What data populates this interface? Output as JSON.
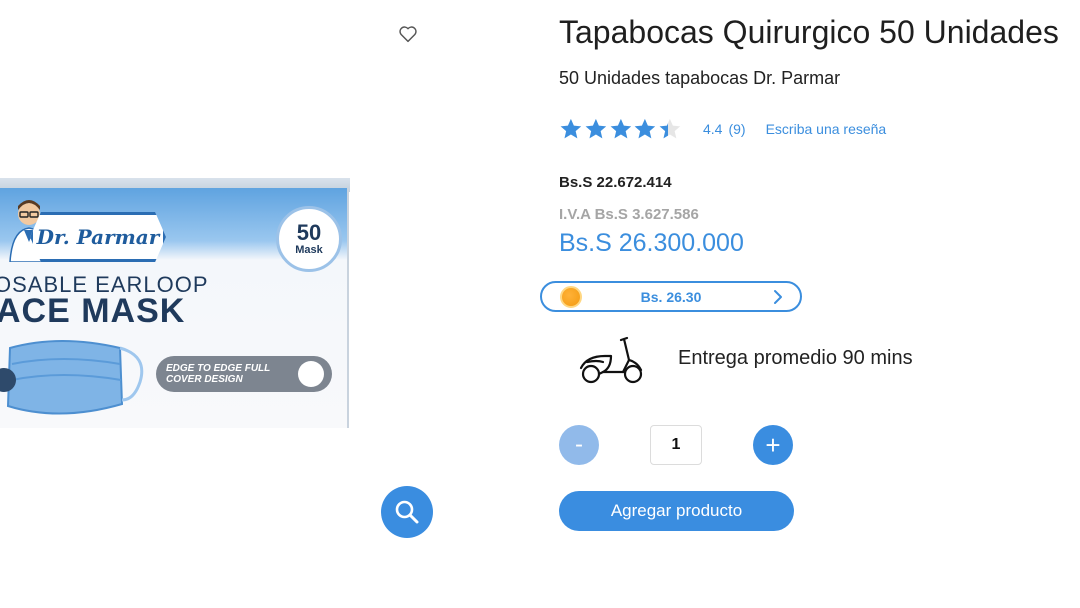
{
  "product": {
    "title": "Tapabocas Quirurgico 50 Unidades",
    "subtitle": "50 Unidades tapabocas Dr. Parmar",
    "image": {
      "brand": "Dr. Parmar",
      "count_number": "50",
      "count_unit": "Mask",
      "line1": "OSABLE EARLOOP",
      "line2": "ACE MASK",
      "feature": "EDGE TO EDGE FULL COVER DESIGN"
    }
  },
  "rating": {
    "value": "4.4",
    "count": "(9)",
    "review_link": "Escriba una reseña",
    "stars_out_of_5": 4.4
  },
  "price": {
    "base": "Bs.S 22.672.414",
    "tax": "I.V.A Bs.S 3.627.586",
    "total": "Bs.S 26.300.000"
  },
  "currency_pill": {
    "label": "Bs. 26.30"
  },
  "delivery": {
    "text": "Entrega promedio 90 mins"
  },
  "quantity": {
    "minus_label": "-",
    "value": "1",
    "plus_label": "+"
  },
  "actions": {
    "add_to_cart": "Agregar producto"
  },
  "colors": {
    "accent": "#3a8de0",
    "accent_light": "#91baea",
    "star": "#3b8ede",
    "tax_gray": "#a5a5a5",
    "coin": "#f39a11"
  },
  "icons": {
    "favorite": "heart-outline-icon",
    "zoom": "search-icon",
    "delivery": "scooter-icon",
    "chevron": "chevron-right-icon",
    "coin": "coin-icon"
  }
}
